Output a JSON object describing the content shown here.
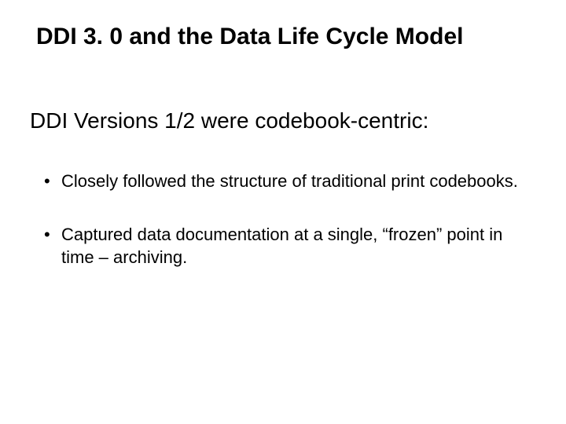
{
  "title": "DDI 3. 0 and the Data Life Cycle Model",
  "subtitle": "DDI Versions 1/2 were codebook-centric:",
  "bullets": [
    "Closely followed the structure of traditional print codebooks.",
    "Captured data documentation at a single, “frozen” point in time – archiving."
  ]
}
